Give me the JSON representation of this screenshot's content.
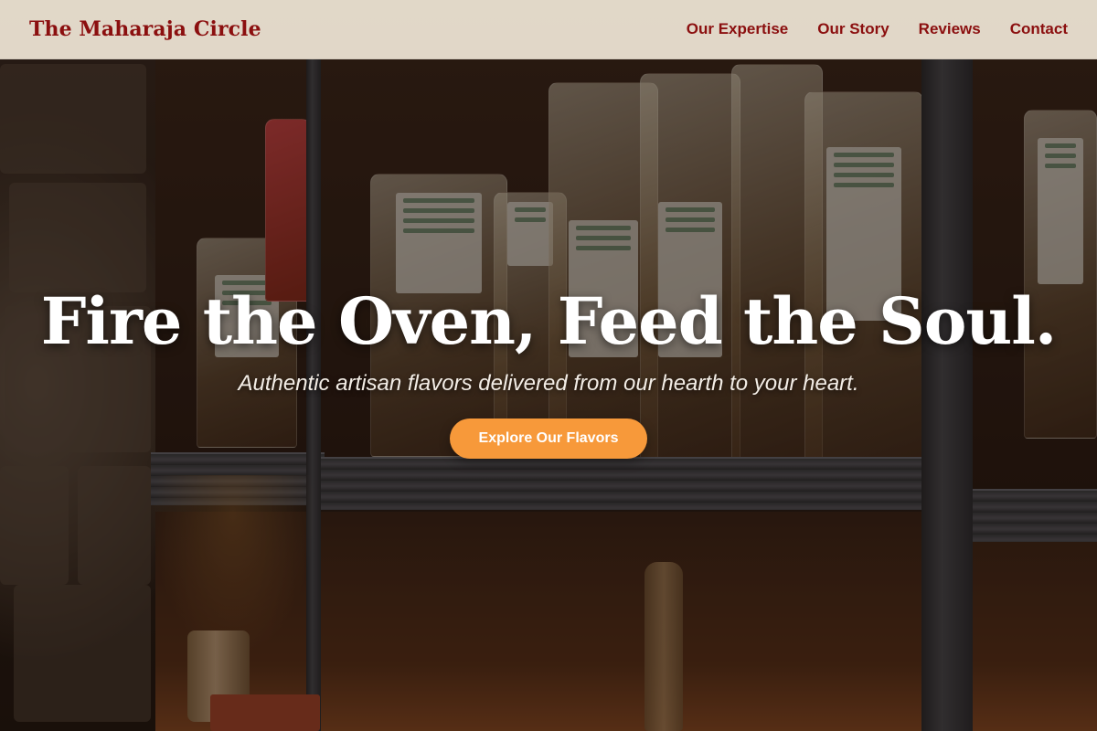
{
  "header": {
    "brand": "The Maharaja Circle",
    "nav": [
      {
        "label": "Our Expertise"
      },
      {
        "label": "Our Story"
      },
      {
        "label": "Reviews"
      },
      {
        "label": "Contact"
      }
    ]
  },
  "hero": {
    "title": "Fire the Oven, Feed the Soul.",
    "subtitle": "Authentic artisan flavors delivered from our hearth to your heart.",
    "cta_label": "Explore Our Flavors"
  },
  "colors": {
    "brand": "#8b0f0f",
    "accent": "#f7993a",
    "nav_background": "#f0e6d6"
  }
}
